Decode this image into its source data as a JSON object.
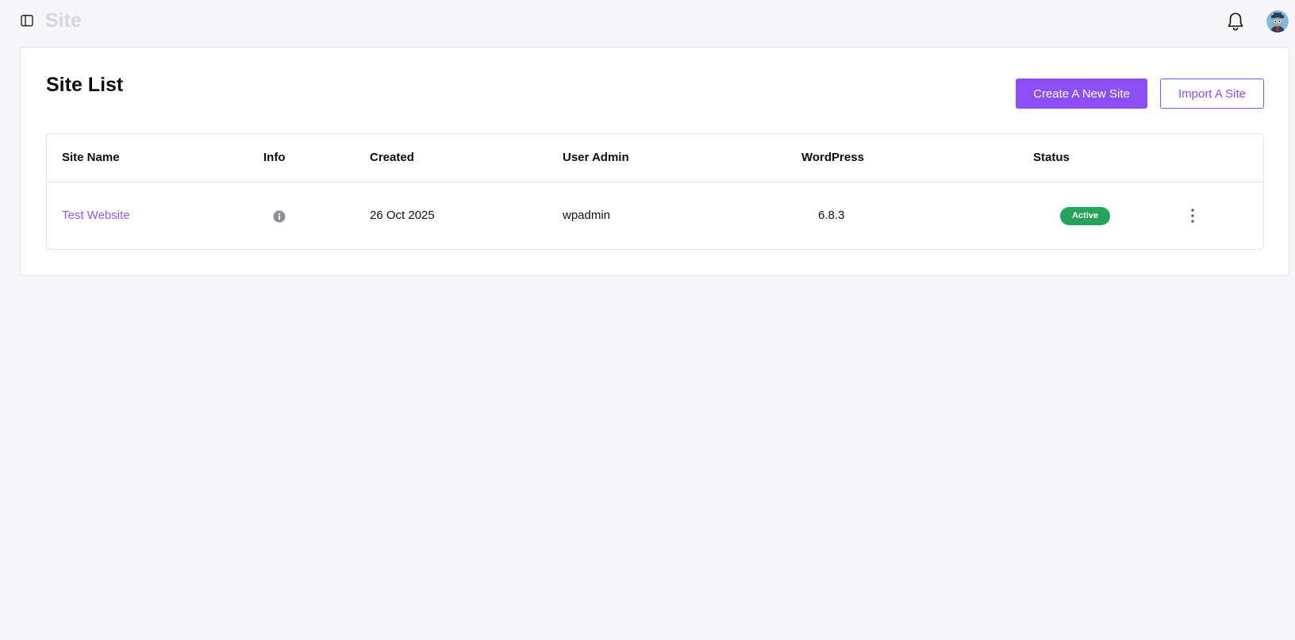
{
  "header": {
    "title": "Site",
    "toggle_icon": "sidebar-toggle-icon",
    "notification_icon": "bell-icon",
    "avatar_icon": "user-avatar"
  },
  "main": {
    "title": "Site List",
    "create_button": "Create A New Site",
    "import_button": "Import A Site"
  },
  "table": {
    "columns": [
      "Site Name",
      "Info",
      "Created",
      "User Admin",
      "WordPress",
      "Status"
    ],
    "rows": [
      {
        "site_name": "Test Website",
        "info_icon": "info-icon",
        "created": "26 Oct 2025",
        "user_admin": "wpadmin",
        "wordpress": "6.8.3",
        "status": "Active",
        "actions_icon": "more-vertical-icon"
      }
    ]
  },
  "colors": {
    "accent": "#8b4ef7",
    "link": "#8b5cf6",
    "status_active": "#22a55a",
    "background": "#f7f7f9"
  }
}
